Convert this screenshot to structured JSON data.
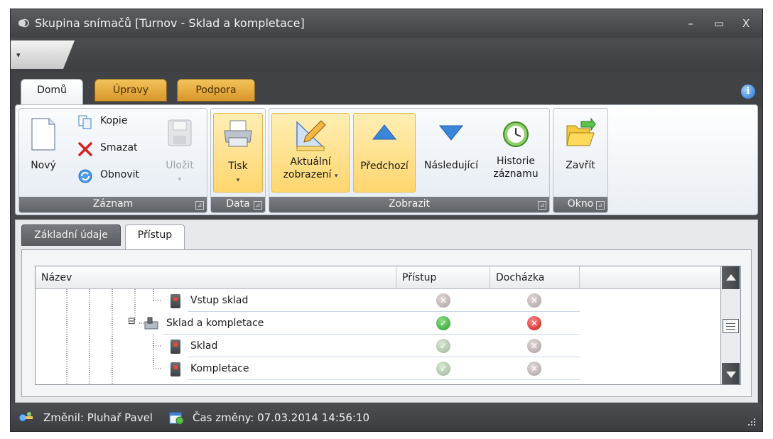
{
  "window": {
    "title": "Skupina snímačů [Turnov - Sklad a kompletace]",
    "controls": {
      "minimize": "–",
      "maximize": "▭",
      "close": "X"
    }
  },
  "quick_access": {
    "menu_glyph": "▾"
  },
  "ribbon_tabs": [
    {
      "label": "Domů",
      "active": true
    },
    {
      "label": "Úpravy",
      "active": false
    },
    {
      "label": "Podpora",
      "active": false
    }
  ],
  "ribbon": {
    "groups": {
      "zaznam": {
        "label": "Záznam",
        "new_label": "Nový",
        "copy_label": "Kopie",
        "delete_label": "Smazat",
        "refresh_label": "Obnovit",
        "save_label": "Uložit"
      },
      "data": {
        "label": "Data",
        "print_label": "Tisk"
      },
      "zobrazit": {
        "label": "Zobrazit",
        "current_view_line1": "Aktuální",
        "current_view_line2": "zobrazení",
        "previous_label": "Předchozí",
        "next_label": "Následující",
        "history_line1": "Historie",
        "history_line2": "záznamu"
      },
      "okno": {
        "label": "Okno",
        "close_label": "Zavřít"
      }
    },
    "launcher_glyph": "⊿",
    "dropdown_glyph": "▾"
  },
  "content_tabs": [
    {
      "label": "Základní údaje",
      "active": false
    },
    {
      "label": "Přístup",
      "active": true
    }
  ],
  "grid": {
    "columns": [
      "Název",
      "Přístup",
      "Docházka"
    ],
    "rows": [
      {
        "name": "Vstup sklad",
        "access": "denied-disabled",
        "attendance": "denied-disabled"
      },
      {
        "name": "Sklad a kompletace",
        "access": "allowed",
        "attendance": "denied"
      },
      {
        "name": "Sklad",
        "access": "allowed-disabled",
        "attendance": "denied-disabled"
      },
      {
        "name": "Kompletace",
        "access": "allowed-disabled",
        "attendance": "denied-disabled"
      }
    ],
    "expander_glyph": "⊟"
  },
  "status_bar": {
    "changed_by": "Změnil: Pluhař Pavel",
    "changed_at": "Čas změny: 07.03.2014 14:56:10"
  },
  "colors": {
    "accent_orange": "#f2c35b",
    "highlight_yellow": "#ffd66e",
    "chrome_dark": "#46484c",
    "ok_green": "#2a9a2a",
    "deny_red": "#c41b1b"
  }
}
